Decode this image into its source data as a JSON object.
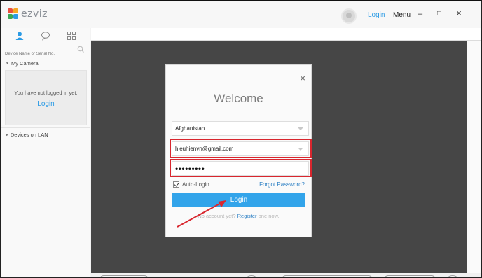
{
  "app": {
    "name": "ezviz",
    "brand_colors": [
      "#e94f3d",
      "#f5a623",
      "#3aa655",
      "#2b9be5"
    ]
  },
  "titlebar": {
    "login_label": "Login",
    "menu_label": "Menu",
    "minimize_icon": "–",
    "maximize_icon": "□",
    "close_icon": "×"
  },
  "sidebar": {
    "tabs": [
      "person-icon",
      "chat-icon",
      "grid-icon"
    ],
    "search_placeholder": "Device Name or Serial No.",
    "my_camera_label": "My Camera",
    "not_logged_msg": "You have not logged in yet.",
    "login_link": "Login",
    "devices_lan_label": "Devices on LAN"
  },
  "dialog": {
    "title": "Welcome",
    "close_icon": "×",
    "country_value": "Afghanistan",
    "email_value": "hieuhienvn@gmail.com",
    "password_mask": "•••••••••",
    "auto_login_label": "Auto-Login",
    "auto_login_checked": true,
    "forgot_label": "Forgot Password?",
    "login_button": "Login",
    "register_prefix": "No account yet?",
    "register_link": "Register",
    "register_suffix": "one now."
  },
  "colors": {
    "accent": "#32a4ea",
    "highlight": "#d9262e",
    "main_bg": "#464646"
  }
}
